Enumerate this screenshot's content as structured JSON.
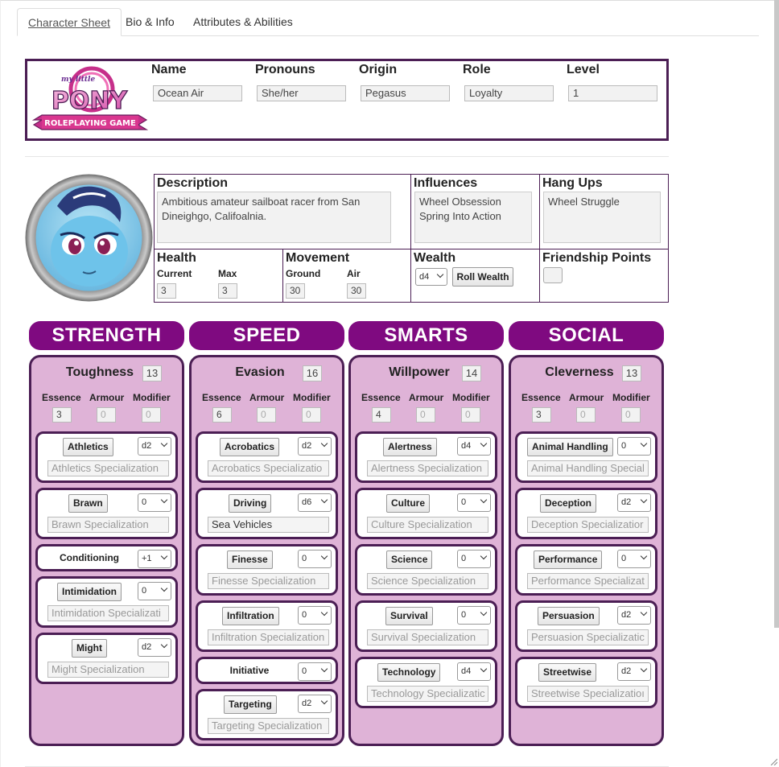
{
  "tabs": [
    {
      "label": "Character Sheet",
      "active": true
    },
    {
      "label": "Bio & Info",
      "active": false
    },
    {
      "label": "Attributes & Abilities",
      "active": false
    }
  ],
  "logo": {
    "top_text": "my little",
    "main_text": "PONY",
    "ribbon_text": "ROLEPLAYING GAME"
  },
  "header": {
    "fields": [
      {
        "label": "Name",
        "value": "Ocean Air"
      },
      {
        "label": "Pronouns",
        "value": "She/her"
      },
      {
        "label": "Origin",
        "value": "Pegasus"
      },
      {
        "label": "Role",
        "value": "Loyalty"
      },
      {
        "label": "Level",
        "value": "1"
      }
    ]
  },
  "info": {
    "description": {
      "label": "Description",
      "value": "Ambitious amateur sailboat racer from San Dineighgo, Califoalnia."
    },
    "influences": {
      "label": "Influences",
      "value": "Wheel Obsession\nSpring Into Action"
    },
    "hangups": {
      "label": "Hang Ups",
      "value": "Wheel Struggle"
    },
    "health": {
      "label": "Health",
      "current_label": "Current",
      "current": "3",
      "max_label": "Max",
      "max": "3"
    },
    "movement": {
      "label": "Movement",
      "ground_label": "Ground",
      "ground": "30",
      "air_label": "Air",
      "air": "30"
    },
    "wealth": {
      "label": "Wealth",
      "die": "d4",
      "roll_label": "Roll Wealth"
    },
    "friendship": {
      "label": "Friendship Points"
    }
  },
  "stat_labels": {
    "essence": "Essence",
    "armour": "Armour",
    "modifier": "Modifier"
  },
  "attributes": [
    {
      "name": "STRENGTH",
      "defense": "Toughness",
      "defense_value": "13",
      "essence": "3",
      "armour": "0",
      "modifier": "0",
      "skills": [
        {
          "name": "Athletics",
          "die": "d2",
          "spec": "Athletics Specialization",
          "has_spec": true
        },
        {
          "name": "Brawn",
          "die": "0",
          "spec": "Brawn Specialization",
          "has_spec": true
        },
        {
          "name": "Conditioning",
          "die": "+1",
          "has_spec": false
        },
        {
          "name": "Intimidation",
          "die": "0",
          "spec": "Intimidation Specializati",
          "has_spec": true
        },
        {
          "name": "Might",
          "die": "d2",
          "spec": "Might Specialization",
          "has_spec": true
        }
      ]
    },
    {
      "name": "SPEED",
      "defense": "Evasion",
      "defense_value": "16",
      "essence": "6",
      "armour": "0",
      "modifier": "0",
      "skills": [
        {
          "name": "Acrobatics",
          "die": "d2",
          "spec": "Acrobatics Specializatio",
          "has_spec": true
        },
        {
          "name": "Driving",
          "die": "d6",
          "spec": "Sea Vehicles",
          "spec_filled": true,
          "has_spec": true
        },
        {
          "name": "Finesse",
          "die": "0",
          "spec": "Finesse Specialization",
          "has_spec": true
        },
        {
          "name": "Infiltration",
          "die": "0",
          "spec": "Infiltration Specialization",
          "has_spec": true
        },
        {
          "name": "Initiative",
          "die": "0",
          "has_spec": false
        },
        {
          "name": "Targeting",
          "die": "d2",
          "spec": "Targeting Specialization",
          "has_spec": true
        }
      ]
    },
    {
      "name": "SMARTS",
      "defense": "Willpower",
      "defense_value": "14",
      "essence": "4",
      "armour": "0",
      "modifier": "0",
      "skills": [
        {
          "name": "Alertness",
          "die": "d4",
          "spec": "Alertness Specialization",
          "has_spec": true
        },
        {
          "name": "Culture",
          "die": "0",
          "spec": "Culture Specialization",
          "has_spec": true
        },
        {
          "name": "Science",
          "die": "0",
          "spec": "Science Specialization",
          "has_spec": true
        },
        {
          "name": "Survival",
          "die": "0",
          "spec": "Survival Specialization",
          "has_spec": true
        },
        {
          "name": "Technology",
          "die": "d4",
          "spec": "Technology Specializatic",
          "has_spec": true
        }
      ]
    },
    {
      "name": "SOCIAL",
      "defense": "Cleverness",
      "defense_value": "13",
      "essence": "3",
      "armour": "0",
      "modifier": "0",
      "skills": [
        {
          "name": "Animal Handling",
          "die": "0",
          "spec": "Animal Handling Special",
          "has_spec": true
        },
        {
          "name": "Deception",
          "die": "d2",
          "spec": "Deception Specializatior",
          "has_spec": true
        },
        {
          "name": "Performance",
          "die": "0",
          "spec": "Performance Specializat",
          "has_spec": true
        },
        {
          "name": "Persuasion",
          "die": "d2",
          "spec": "Persuasion Specializatic",
          "has_spec": true
        },
        {
          "name": "Streetwise",
          "die": "d2",
          "spec": "Streetwise Specializatioı",
          "has_spec": true
        }
      ]
    }
  ],
  "colors": {
    "accent": "#7f0a80",
    "border": "#4b1e54",
    "panel": "#dfb3d7"
  }
}
